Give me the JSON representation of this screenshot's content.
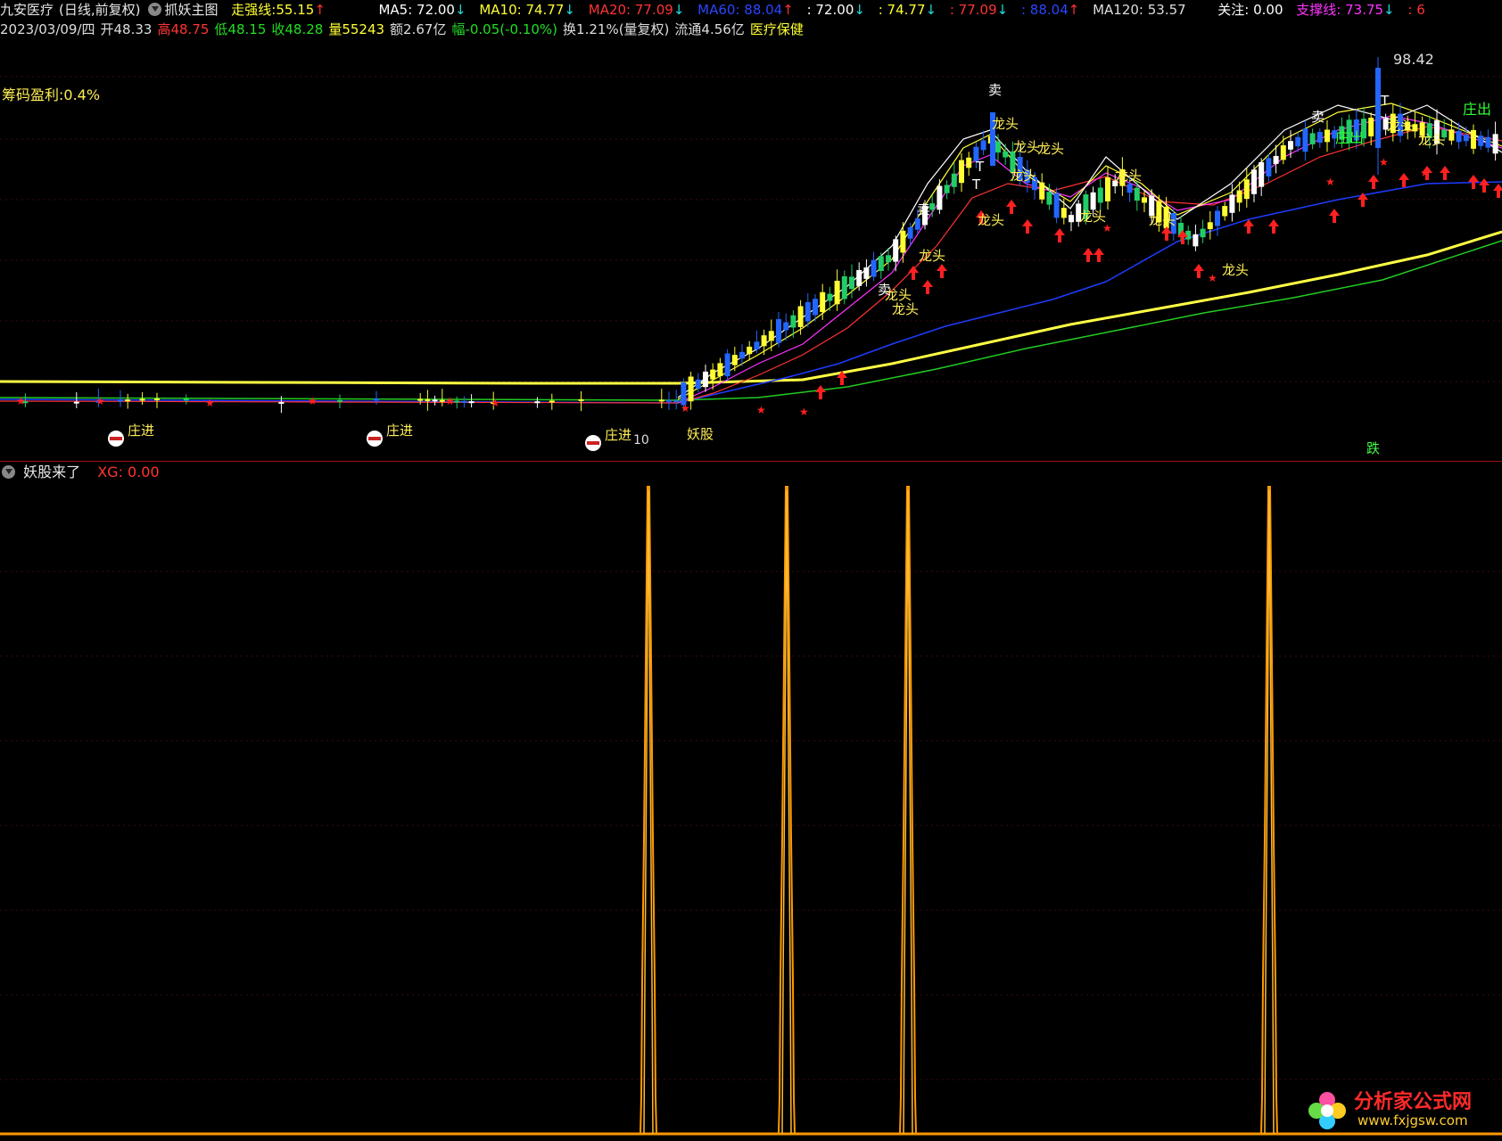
{
  "header": {
    "stock_name": "九安医疗",
    "period": "(日线,前复权)",
    "indicator_name": "抓妖主图",
    "strength_label": "走强线:",
    "strength_value": "55.15",
    "ma5": "MA5: 72.00",
    "ma10": "MA10: 74.77",
    "ma20": "MA20: 77.09",
    "ma60": "MA60: 88.04",
    "ma_extra1": ": 72.00",
    "ma_extra2": ": 74.77",
    "ma_extra3": ": 77.09",
    "ma_extra4": ": 88.04",
    "ma120": "MA120: 53.57",
    "focus": "关注: 0.00",
    "support": "支撑线: 73.75",
    "tail": ": 6",
    "arrow_up": "↑",
    "arrow_down": "↓"
  },
  "quote": {
    "date": "2023/03/09/四",
    "open": "开48.33",
    "high": "高48.75",
    "low": "低48.15",
    "close": "收48.28",
    "volume": "量55243",
    "amount": "额2.67亿",
    "change": "幅-0.05(-0.10%)",
    "turnover": "换1.21%(量复权)",
    "float_cap": "流通4.56亿",
    "sector": "医疗保健"
  },
  "main_chart": {
    "chip_profit": "筹码盈利:0.4%",
    "peak_price": "98.42",
    "sell_label": "卖",
    "dragon_label": "龙头",
    "zhuang_jin": "庄进",
    "zhuang_chu": "庄出",
    "yaogu": "妖股",
    "low_marker": "10",
    "die_label": "跌",
    "t_label": "T"
  },
  "sub_chart": {
    "title": "妖股来了",
    "xg_label": "XG: 0.00",
    "signal_bars": [
      727,
      882,
      1018,
      1423
    ]
  },
  "watermark": {
    "cn": "分析家公式网",
    "url": "www.fxjgsw.com"
  },
  "colors": {
    "ma5": "#ffffff",
    "ma10": "#ffff33",
    "ma20": "#ff3333",
    "ma60": "#1e3cff",
    "ma120_thick": "#ffff44",
    "long_green": "#22cc22",
    "signal": "#ff9900",
    "up_red": "#ff2020",
    "divider": "#a01010"
  }
}
